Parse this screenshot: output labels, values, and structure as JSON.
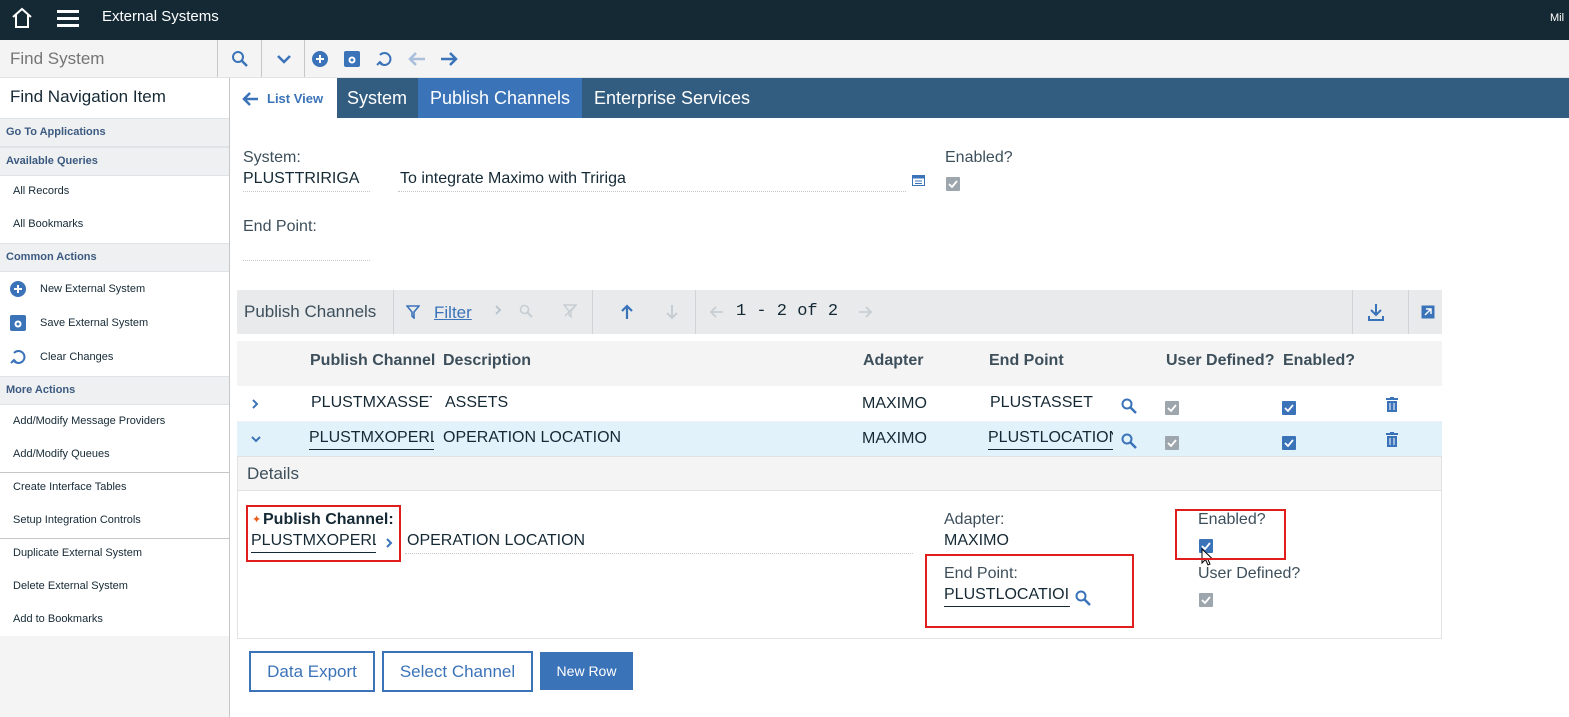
{
  "header": {
    "title": "External Systems",
    "user": "Mil"
  },
  "find": {
    "placeholder": "Find System"
  },
  "sidebar": {
    "find_nav": "Find Navigation Item",
    "go_to": "Go To Applications",
    "queries_title": "Available Queries",
    "queries": [
      "All Records",
      "All Bookmarks"
    ],
    "common_title": "Common Actions",
    "common": [
      "New External System",
      "Save External System",
      "Clear Changes"
    ],
    "more_title": "More Actions",
    "more": [
      "Add/Modify Message Providers",
      "Add/Modify Queues",
      "Create Interface Tables",
      "Setup Integration Controls",
      "Duplicate External System",
      "Delete External System",
      "Add to Bookmarks"
    ]
  },
  "tabs": {
    "list_view": "List View",
    "items": [
      "System",
      "Publish Channels",
      "Enterprise Services"
    ],
    "active": "Publish Channels"
  },
  "form": {
    "system_label": "System:",
    "system_value": "PLUSTTRIRIGA",
    "description": "To integrate Maximo with Tririga",
    "enabled_label": "Enabled?",
    "endpoint_label": "End Point:",
    "endpoint_value": ""
  },
  "table": {
    "title": "Publish Channels",
    "filter": "Filter",
    "pagination": "1 - 2 of 2",
    "columns": [
      "Publish Channel",
      "Description",
      "Adapter",
      "End Point",
      "User Defined?",
      "Enabled?"
    ],
    "rows": [
      {
        "channel": "PLUSTMXASSET",
        "description": "ASSETS",
        "adapter": "MAXIMO",
        "endpoint": "PLUSTASSET",
        "user_defined": true,
        "enabled": true
      },
      {
        "channel": "PLUSTMXOPERLOC",
        "description": "OPERATION LOCATION",
        "adapter": "MAXIMO",
        "endpoint": "PLUSTLOCATION",
        "user_defined": true,
        "enabled": true
      }
    ]
  },
  "details": {
    "title": "Details",
    "channel_label": "Publish Channel:",
    "channel_value": "PLUSTMXOPERL",
    "description": "OPERATION LOCATION",
    "adapter_label": "Adapter:",
    "adapter_value": "MAXIMO",
    "endpoint_label": "End Point:",
    "endpoint_value": "PLUSTLOCATIOI",
    "enabled_label": "Enabled?",
    "user_defined_label": "User Defined?"
  },
  "buttons": {
    "data_export": "Data Export",
    "select_channel": "Select Channel",
    "new_row": "New Row"
  },
  "colors": {
    "topbar": "#152935",
    "tabbar": "#325c80",
    "active_tab": "#3b73b9",
    "accent": "#3b73b9",
    "highlight": "#e01e1e"
  },
  "icons": [
    "home-icon",
    "hamburger-icon",
    "search-icon",
    "chevron-down-icon",
    "add-icon",
    "save-icon",
    "undo-icon",
    "arrow-left-icon",
    "arrow-right-icon",
    "filter-icon",
    "download-icon",
    "trash-icon",
    "lookup-icon"
  ]
}
